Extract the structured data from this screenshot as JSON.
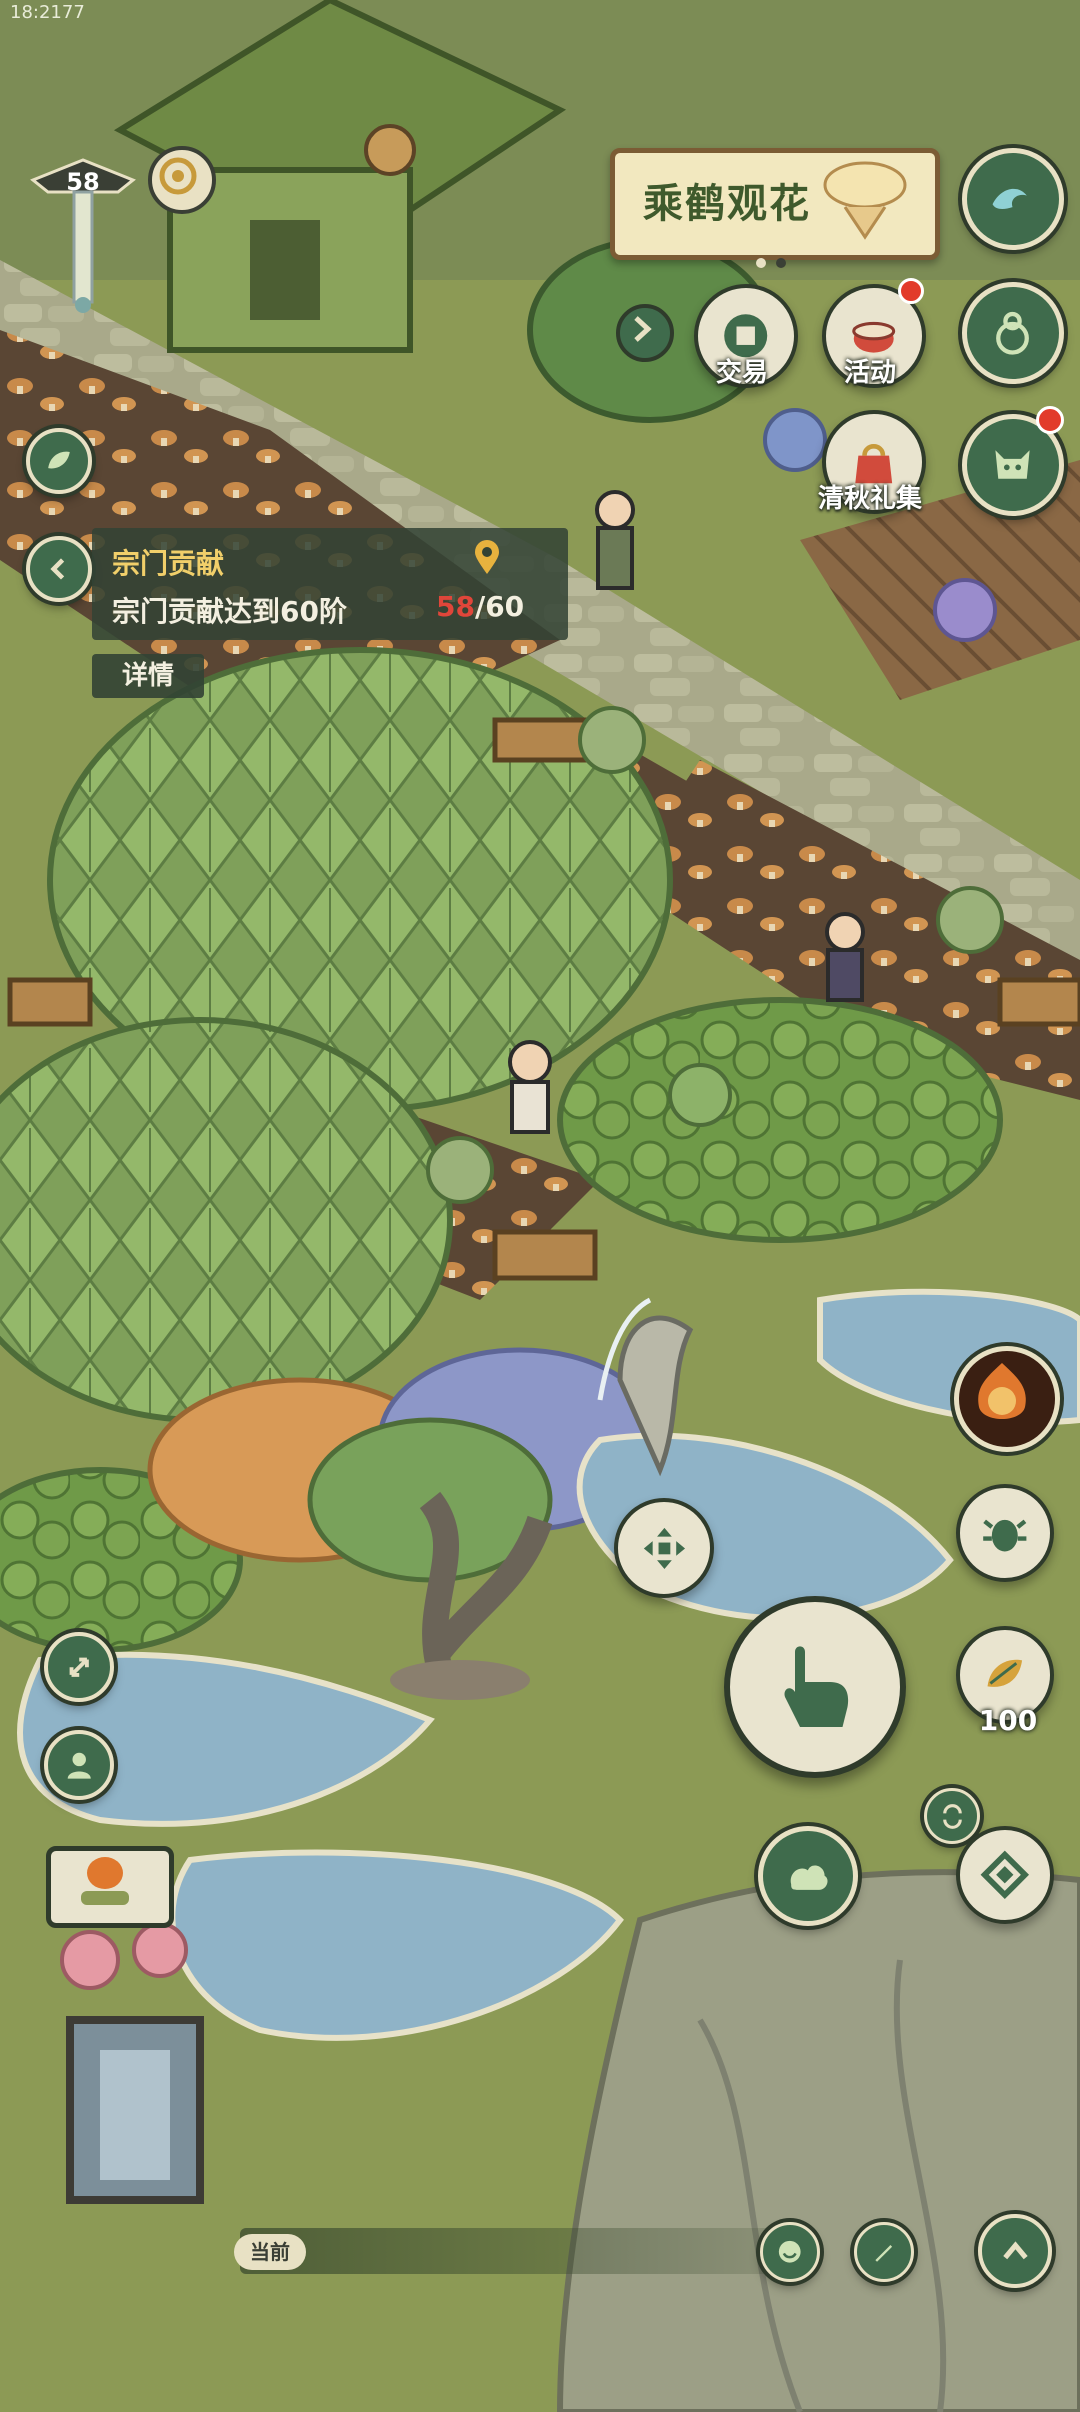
{
  "status_bar": {
    "time": "18:2177"
  },
  "level": {
    "value": "58"
  },
  "event_banner": {
    "title": "乘鹤观花"
  },
  "shortcuts": {
    "trade_label": "交易",
    "activity_label": "活动",
    "gift_label": "清秋礼集"
  },
  "quest": {
    "title": "宗门贡献",
    "description": "宗门贡献达到60阶",
    "progress_current": "58",
    "progress_sep": "/",
    "progress_total": "60",
    "progress_fraction": 0.9667,
    "details_label": "详情"
  },
  "resource": {
    "count": "100"
  },
  "chat": {
    "channel_label": "当前"
  },
  "colors": {
    "button_green": "#3f6b4c",
    "button_rim": "#e8e1c4",
    "panel_bg": "#324234",
    "progress_red": "#e0463a",
    "notification_dot": "#e23b2b"
  }
}
